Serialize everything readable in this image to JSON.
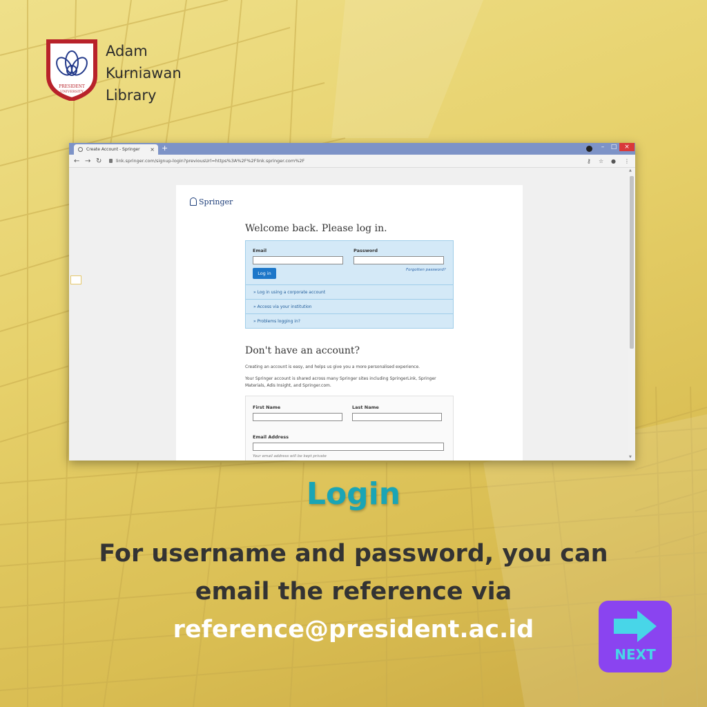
{
  "brand": {
    "line1": "Adam",
    "line2": "Kurniawan",
    "line3": "Library",
    "logo_text_1": "PRESIDENT",
    "logo_text_2": "UNIVERSITY"
  },
  "browser": {
    "tab_title": "Create Account - Springer",
    "tab_close": "×",
    "new_tab": "+",
    "url": "link.springer.com/signup-login?previousUrl=https%3A%2F%2Flink.springer.com%2F",
    "window_controls": [
      "–",
      "□",
      "×"
    ]
  },
  "page": {
    "logo": "Springer",
    "welcome": "Welcome back. Please log in.",
    "email_label": "Email",
    "password_label": "Password",
    "forgot": "Forgotten password?",
    "login_button": "Log in",
    "links": [
      "» Log in using a corporate account",
      "» Access via your institution",
      "» Problems logging in?"
    ],
    "no_account": "Don't have an account?",
    "para1": "Creating an account is easy, and helps us give you a more personalised experience.",
    "para2": "Your Springer account is shared across many Springer sites including SpringerLink, Springer Materials, Adis Insight, and Springer.com.",
    "first_name": "First Name",
    "last_name": "Last Name",
    "email_address": "Email Address",
    "email_hint": "Your email address will be kept private"
  },
  "caption": {
    "title": "Login",
    "line1": "For username and password, you can",
    "line2": "email the reference via",
    "email": "reference@president.ac.id"
  },
  "next": {
    "label": "NEXT"
  },
  "colors": {
    "accent": "#1aa5b5",
    "next_bg": "#8a44f0",
    "next_fg": "#48d6e8",
    "springer": "#1b3c78"
  }
}
